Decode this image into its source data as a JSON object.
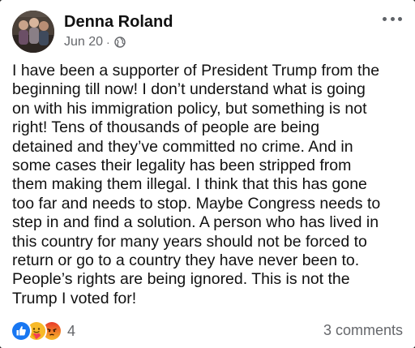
{
  "post": {
    "author": "Denna Roland",
    "date": "Jun 20",
    "separator": "·",
    "audience_icon": "globe-icon",
    "lines": [
      "I have been a supporter of President Trump from the",
      "beginning till now! I don’t understand what is going",
      "on with his immigration policy, but something is not",
      "right! Tens of thousands of people are being",
      "detained and they’ve committed no crime. And in",
      "some cases their legality has been stripped from",
      "them making them illegal. I think that this has gone",
      "too far and needs to stop. Maybe Congress needs to",
      "step in and find a solution. A person who has lived in",
      "this country for many years should not be forced to",
      "return or go to a country they have never been to.",
      "People’s rights are being ignored. This is not the",
      "Trump I voted for!"
    ]
  },
  "reactions": {
    "icons": [
      "like-icon",
      "care-icon",
      "angry-icon"
    ],
    "count": "4"
  },
  "comments_label": "3 comments",
  "colors": {
    "like": "#1877f2",
    "care": "#f7b928",
    "angry": "#e9710f",
    "meta_text": "#65676b"
  }
}
